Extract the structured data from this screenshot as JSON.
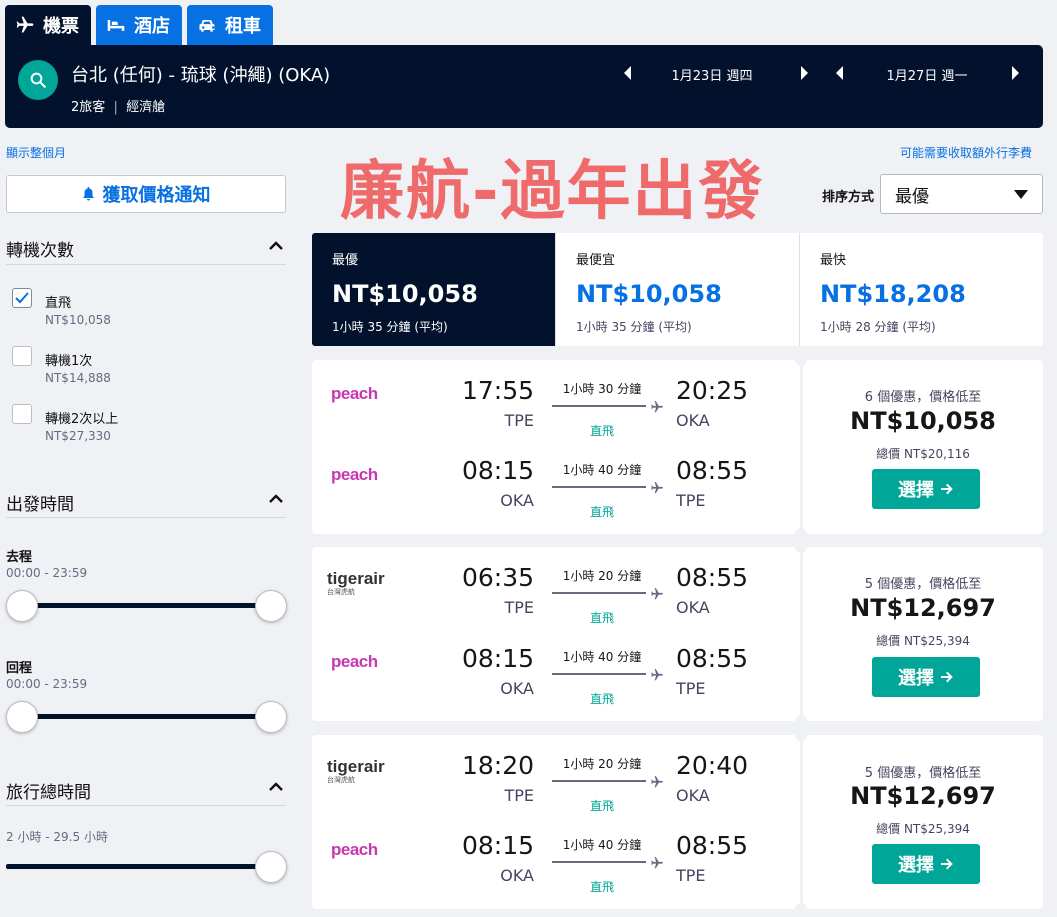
{
  "tabs": [
    {
      "label": "機票",
      "icon": "plane-icon",
      "active": true
    },
    {
      "label": "酒店",
      "icon": "bed-icon",
      "active": false
    },
    {
      "label": "租車",
      "icon": "car-icon",
      "active": false
    }
  ],
  "search": {
    "route": "台北 (任何) - 琉球 (沖繩) (OKA)",
    "travellers": "2旅客",
    "cabin": "經濟艙",
    "depart_date": "1月23日 週四",
    "return_date": "1月27日 週一"
  },
  "links": {
    "whole_month": "顯示整個月",
    "fees_note": "可能需要收取額外行李費"
  },
  "overlay_title": "廉航-過年出發",
  "sort": {
    "label": "排序方式",
    "value": "最優"
  },
  "price_alert": "獲取價格通知",
  "filters": {
    "stops": {
      "title": "轉機次數",
      "options": [
        {
          "label": "直飛",
          "price": "NT$10,058",
          "checked": true
        },
        {
          "label": "轉機1次",
          "price": "NT$14,888",
          "checked": false
        },
        {
          "label": "轉機2次以上",
          "price": "NT$27,330",
          "checked": false
        }
      ]
    },
    "times": {
      "title": "出發時間",
      "outbound_label": "去程",
      "outbound_range": "00:00 - 23:59",
      "return_label": "回程",
      "return_range": "00:00 - 23:59"
    },
    "duration": {
      "title": "旅行總時間",
      "range": "2 小時 - 29.5 小時"
    }
  },
  "summary": [
    {
      "label": "最優",
      "price": "NT$10,058",
      "duration": "1小時 35 分鐘 (平均)",
      "active": true
    },
    {
      "label": "最便宜",
      "price": "NT$10,058",
      "duration": "1小時 35 分鐘 (平均)",
      "active": false
    },
    {
      "label": "最快",
      "price": "NT$18,208",
      "duration": "1小時 28 分鐘 (平均)",
      "active": false
    }
  ],
  "results": [
    {
      "legs": [
        {
          "airline": "peach",
          "dep_time": "17:55",
          "dep_code": "TPE",
          "duration": "1小時 30 分鐘",
          "stops": "直飛",
          "arr_time": "20:25",
          "arr_code": "OKA"
        },
        {
          "airline": "peach",
          "dep_time": "08:15",
          "dep_code": "OKA",
          "duration": "1小時 40 分鐘",
          "stops": "直飛",
          "arr_time": "08:55",
          "arr_code": "TPE"
        }
      ],
      "deals": "6 個優惠，價格低至",
      "price": "NT$10,058",
      "total": "總價 NT$20,116",
      "button": "選擇"
    },
    {
      "legs": [
        {
          "airline": "tigerair",
          "airline_sub": "台灣虎航",
          "dep_time": "06:35",
          "dep_code": "TPE",
          "duration": "1小時 20 分鐘",
          "stops": "直飛",
          "arr_time": "08:55",
          "arr_code": "OKA"
        },
        {
          "airline": "peach",
          "dep_time": "08:15",
          "dep_code": "OKA",
          "duration": "1小時 40 分鐘",
          "stops": "直飛",
          "arr_time": "08:55",
          "arr_code": "TPE"
        }
      ],
      "deals": "5 個優惠，價格低至",
      "price": "NT$12,697",
      "total": "總價 NT$25,394",
      "button": "選擇"
    },
    {
      "legs": [
        {
          "airline": "tigerair",
          "airline_sub": "台灣虎航",
          "dep_time": "18:20",
          "dep_code": "TPE",
          "duration": "1小時 20 分鐘",
          "stops": "直飛",
          "arr_time": "20:40",
          "arr_code": "OKA"
        },
        {
          "airline": "peach",
          "dep_time": "08:15",
          "dep_code": "OKA",
          "duration": "1小時 40 分鐘",
          "stops": "直飛",
          "arr_time": "08:55",
          "arr_code": "TPE"
        }
      ],
      "deals": "5 個優惠，價格低至",
      "price": "NT$12,697",
      "total": "總價 NT$25,394",
      "button": "選擇"
    }
  ],
  "colors": {
    "navy": "#02122c",
    "blue": "#0770e3",
    "teal": "#00a698",
    "overlay_red": "#ef6b6b",
    "peach_pink": "#c837b0"
  }
}
